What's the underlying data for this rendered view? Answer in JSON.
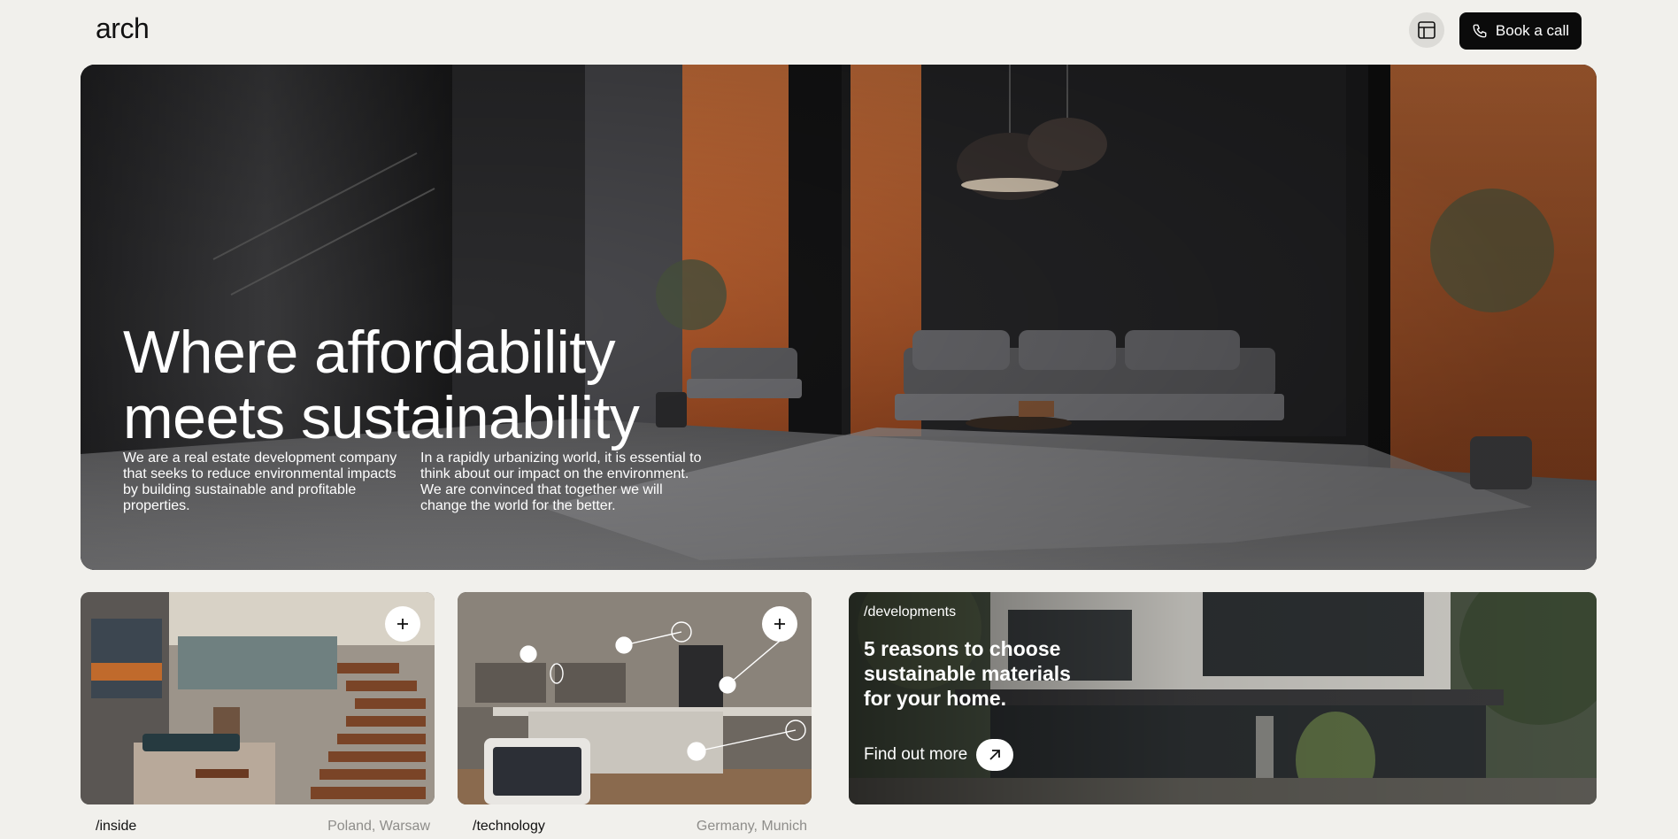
{
  "header": {
    "logo": "arch",
    "layout_icon": "layout-icon",
    "book_button": {
      "label": "Book a call",
      "icon": "phone-icon"
    }
  },
  "hero": {
    "title_line_1": "Where affordability",
    "title_line_2": "meets sustainability",
    "text_left": "We are a real estate development company that seeks to reduce environmental impacts by building sustainable and profitable properties.",
    "text_right": "In a rapidly urbanizing world, it is essential to think about our impact on the environment. We are convinced that together we will change the world for the better."
  },
  "cards": [
    {
      "tag": "/inside",
      "location": "Poland, Warsaw",
      "action_icon": "plus-icon"
    },
    {
      "tag": "/technology",
      "location": "Germany, Munich",
      "action_icon": "plus-icon"
    }
  ],
  "developments": {
    "tag": "/developments",
    "title_line_1": "5 reasons to choose",
    "title_line_2": "sustainable materials",
    "title_line_3": "for your home.",
    "link_label": "Find out more",
    "link_icon": "arrow-up-right-icon"
  },
  "colors": {
    "background": "#f1f0ec",
    "button_dark": "#0b0b0b",
    "accent_orange": "#c4622d",
    "muted_text": "#8e8d8a"
  }
}
